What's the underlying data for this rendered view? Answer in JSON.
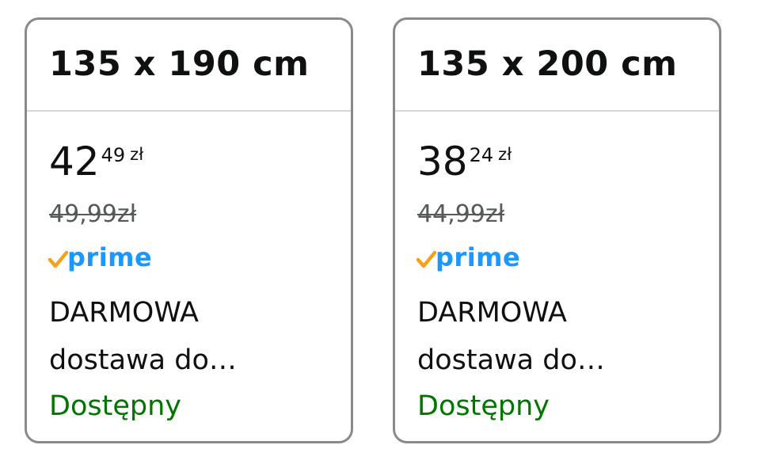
{
  "cards": [
    {
      "size": "135 x 190 cm",
      "price_whole": "42",
      "price_fraction": "49",
      "currency": "zł",
      "old_price": "49,99zł",
      "badge": "prime",
      "delivery_line1": "DARMOWA",
      "delivery_line2": "dostawa do…",
      "availability": "Dostępny"
    },
    {
      "size": "135 x 200 cm",
      "price_whole": "38",
      "price_fraction": "24",
      "currency": "zł",
      "old_price": "44,99zł",
      "badge": "prime",
      "delivery_line1": "DARMOWA",
      "delivery_line2": "dostawa do…",
      "availability": "Dostępny"
    }
  ],
  "colors": {
    "prime_blue": "#1a98ff",
    "prime_check": "#f7a11a",
    "availability_green": "#007600",
    "border": "#8a8a8a"
  },
  "icons": {
    "prime": "prime-check-icon"
  }
}
